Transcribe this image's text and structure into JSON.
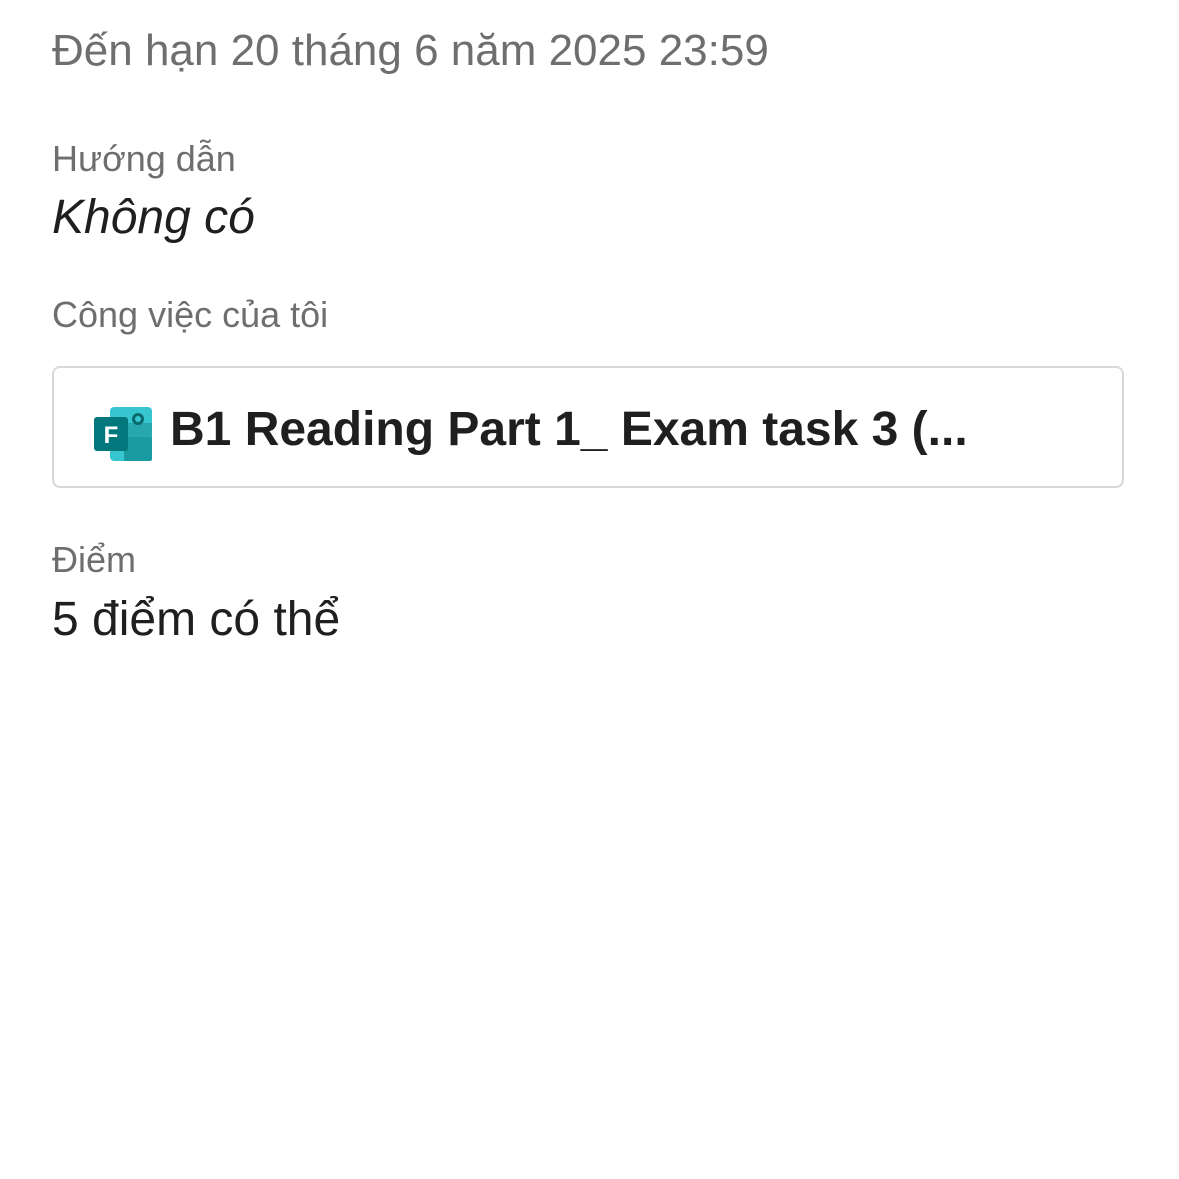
{
  "assignment": {
    "due_text": "Đến hạn 20 tháng 6 năm 2025 23:59",
    "instructions_label": "Hướng dẫn",
    "instructions_value": "Không có",
    "my_work_label": "Công việc của tôi",
    "my_work_item": {
      "icon": "microsoft-forms-icon",
      "title": "B1 Reading Part 1_ Exam task 3 (..."
    },
    "points_label": "Điểm",
    "points_value": "5 điểm có thể"
  },
  "colors": {
    "forms_brand_dark": "#03787C",
    "forms_brand_light": "#37C6D0",
    "secondary_text": "#6e6e6e",
    "primary_text": "#1f1f1f",
    "card_border": "#d8d8d8"
  }
}
